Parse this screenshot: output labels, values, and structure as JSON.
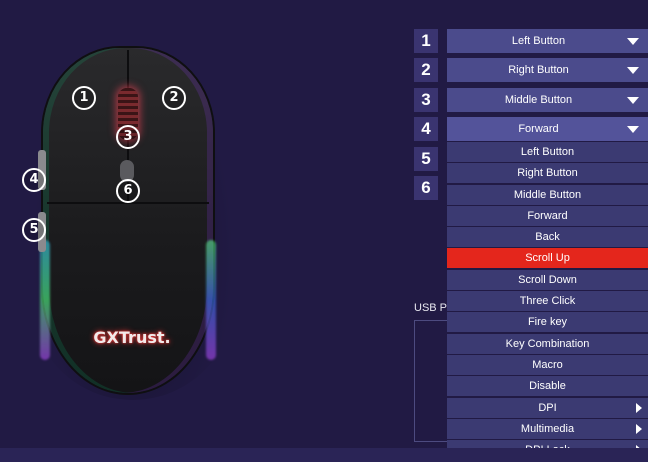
{
  "mouse": {
    "brand_logo": "GXTrust.",
    "hotspots": [
      "1",
      "2",
      "3",
      "4",
      "5",
      "6"
    ]
  },
  "assignments": [
    {
      "number": "1",
      "value": "Left Button"
    },
    {
      "number": "2",
      "value": "Right Button"
    },
    {
      "number": "3",
      "value": "Middle Button"
    },
    {
      "number": "4",
      "value": "Forward"
    },
    {
      "number": "5",
      "value": ""
    },
    {
      "number": "6",
      "value": ""
    }
  ],
  "dropdown": {
    "items": [
      {
        "label": "Left Button"
      },
      {
        "label": "Right Button"
      },
      {
        "label": "Middle Button"
      },
      {
        "label": "Forward"
      },
      {
        "label": "Back"
      },
      {
        "label": "Scroll Up",
        "selected": true
      },
      {
        "label": "Scroll Down"
      },
      {
        "label": "Three Click"
      },
      {
        "label": "Fire key"
      },
      {
        "label": "Key Combination"
      },
      {
        "label": "Macro"
      },
      {
        "label": "Disable"
      },
      {
        "label": "DPI",
        "submenu": true
      },
      {
        "label": "Multimedia",
        "submenu": true
      },
      {
        "label": "DPI Lock",
        "submenu": true
      }
    ]
  },
  "usb_label": "USB P",
  "colors": {
    "background": "#211a44",
    "select": "#4b4b8c",
    "dropdown": "#3b3a72",
    "selected": "#e4261c"
  }
}
